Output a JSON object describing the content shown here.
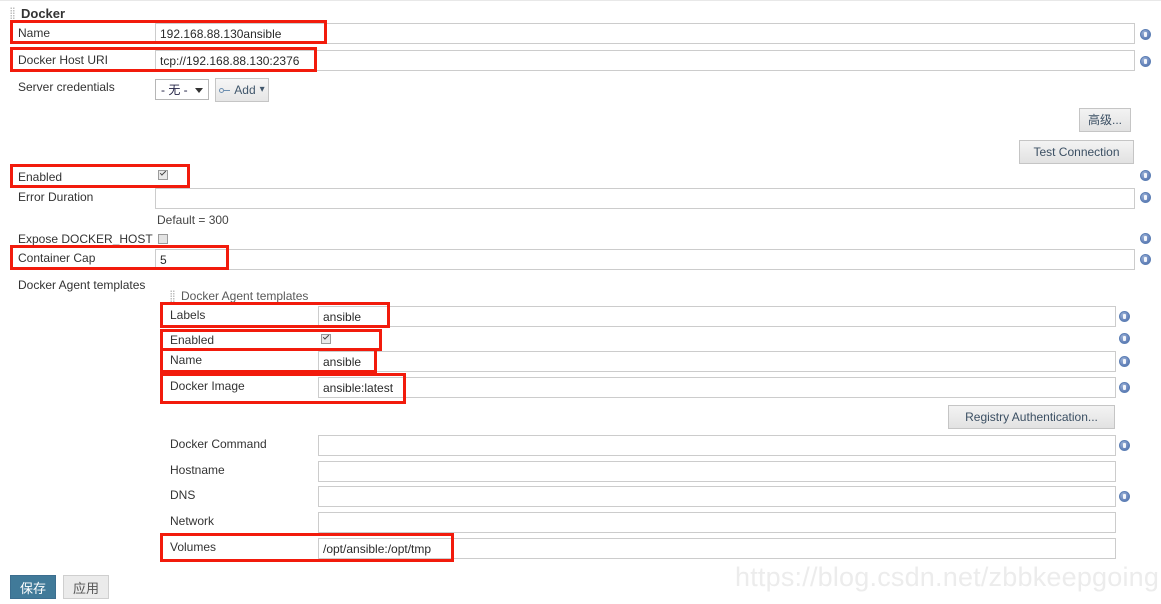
{
  "page": {
    "watermark": "https://blog.csdn.net/zbbkeepgoing"
  },
  "cloud": {
    "section_title": "Docker",
    "fields": {
      "name_label": "Name",
      "name_value": "192.168.88.130ansible",
      "host_uri_label": "Docker Host URI",
      "host_uri_value": "tcp://192.168.88.130:2376",
      "credentials_label": "Server credentials",
      "credentials_selected": "- 无 -",
      "add_button": "Add",
      "enabled_label": "Enabled",
      "error_duration_label": "Error Duration",
      "error_duration_value": "",
      "error_duration_hint": "Default = 300",
      "expose_docker_host_label": "Expose DOCKER_HOST",
      "container_cap_label": "Container Cap",
      "container_cap_value": "5",
      "agent_templates_label": "Docker Agent templates"
    },
    "buttons": {
      "advanced": "高级...",
      "test_connection": "Test Connection"
    }
  },
  "template": {
    "section_title": "Docker Agent templates",
    "fields": {
      "labels_label": "Labels",
      "labels_value": "ansible",
      "enabled_label": "Enabled",
      "name_label": "Name",
      "name_value": "ansible",
      "docker_image_label": "Docker Image",
      "docker_image_value": "ansible:latest",
      "docker_command_label": "Docker Command",
      "docker_command_value": "",
      "hostname_label": "Hostname",
      "hostname_value": "",
      "dns_label": "DNS",
      "dns_value": "",
      "network_label": "Network",
      "network_value": "",
      "volumes_label": "Volumes",
      "volumes_value": "/opt/ansible:/opt/tmp",
      "volumes_hint": ""
    },
    "buttons": {
      "registry_authentication": "Registry Authentication..."
    }
  },
  "footer": {
    "save_button": "保存",
    "apply_button": "应用"
  },
  "colors": {
    "highlight": "#f21b0c",
    "primary_button": "#417a99",
    "help_icon": "#5d7fb5"
  }
}
